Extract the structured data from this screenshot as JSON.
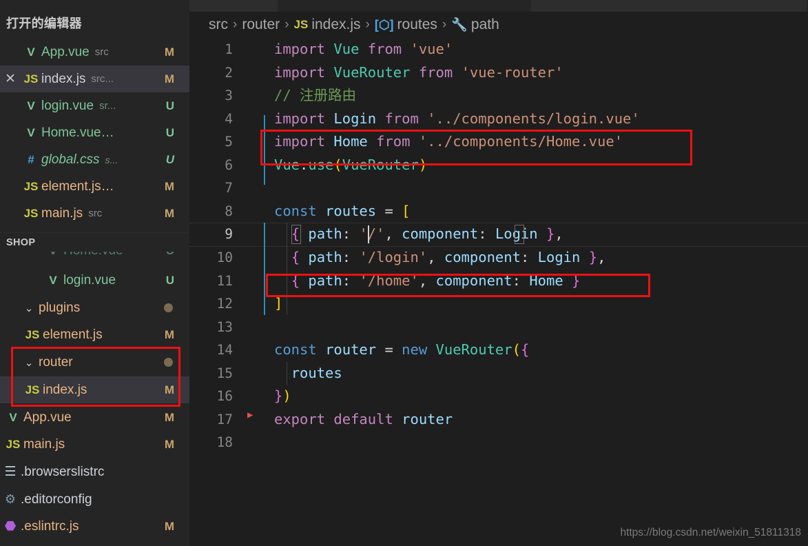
{
  "window": {
    "app": "Visual Studio Code",
    "theme_bg": "#1e1e1e",
    "sidebar_bg": "#252526",
    "accent_red": "#ee1111",
    "selection_bg": "#37373d"
  },
  "sidebar": {
    "open_editors": {
      "title": "打开的编辑器",
      "items": [
        {
          "icon": "vue-file-icon",
          "name": "App.vue",
          "path": "src",
          "status": "M",
          "selected": false,
          "closable": false,
          "italic": false
        },
        {
          "icon": "js-file-icon",
          "name": "index.js",
          "path": "src...",
          "status": "M",
          "selected": true,
          "closable": true,
          "italic": false
        },
        {
          "icon": "vue-file-icon",
          "name": "login.vue",
          "path": "sr...",
          "status": "U",
          "selected": false,
          "closable": false,
          "italic": false
        },
        {
          "icon": "vue-file-icon",
          "name": "Home.vue…",
          "path": "",
          "status": "U",
          "selected": false,
          "closable": false,
          "italic": false
        },
        {
          "icon": "css-file-icon",
          "name": "global.css",
          "path": "s...",
          "status": "U",
          "selected": false,
          "closable": false,
          "italic": true
        },
        {
          "icon": "js-file-icon",
          "name": "element.js…",
          "path": "",
          "status": "M",
          "selected": false,
          "closable": false,
          "italic": false
        },
        {
          "icon": "js-file-icon",
          "name": "main.js",
          "path": "src",
          "status": "M",
          "selected": false,
          "closable": false,
          "italic": false
        }
      ]
    },
    "explorer": {
      "title": "SHOP",
      "items": [
        {
          "icon": "vue-file-icon",
          "name": "Home.vue",
          "status": "U",
          "indent": 2,
          "kind": "file",
          "clipped": true,
          "selected": false,
          "expanded": null
        },
        {
          "icon": "vue-file-icon",
          "name": "login.vue",
          "status": "U",
          "indent": 2,
          "kind": "file",
          "clipped": false,
          "selected": false,
          "expanded": null
        },
        {
          "icon": "folder",
          "name": "plugins",
          "status": "dot",
          "indent": 1,
          "kind": "folder",
          "clipped": false,
          "selected": false,
          "expanded": true
        },
        {
          "icon": "js-file-icon",
          "name": "element.js",
          "status": "M",
          "indent": 2,
          "kind": "file",
          "clipped": false,
          "selected": false,
          "expanded": null
        },
        {
          "icon": "folder",
          "name": "router",
          "status": "dot",
          "indent": 1,
          "kind": "folder",
          "clipped": false,
          "selected": false,
          "expanded": true
        },
        {
          "icon": "js-file-icon",
          "name": "index.js",
          "status": "M",
          "indent": 2,
          "kind": "file",
          "clipped": false,
          "selected": true,
          "expanded": null
        },
        {
          "icon": "vue-file-icon",
          "name": "App.vue",
          "status": "M",
          "indent": 1,
          "kind": "file",
          "clipped": false,
          "selected": false,
          "expanded": null
        },
        {
          "icon": "js-file-icon",
          "name": "main.js",
          "status": "M",
          "indent": 1,
          "kind": "file",
          "clipped": false,
          "selected": false,
          "expanded": null
        },
        {
          "icon": "list-file-icon",
          "name": ".browserslistrc",
          "status": "",
          "indent": 0,
          "kind": "file",
          "clipped": false,
          "selected": false,
          "expanded": null
        },
        {
          "icon": "gear-file-icon",
          "name": ".editorconfig",
          "status": "",
          "indent": 0,
          "kind": "file",
          "clipped": false,
          "selected": false,
          "expanded": null
        },
        {
          "icon": "eslint-file-icon",
          "name": ".eslintrc.js",
          "status": "M",
          "indent": 0,
          "kind": "file",
          "clipped": false,
          "selected": false,
          "expanded": null
        }
      ]
    }
  },
  "editor": {
    "breadcrumb": [
      {
        "label": "src",
        "icon": ""
      },
      {
        "label": "router",
        "icon": ""
      },
      {
        "label": "index.js",
        "icon": "js-file-icon"
      },
      {
        "label": "routes",
        "icon": "symbol-variable-icon"
      },
      {
        "label": "path",
        "icon": "symbol-property-wrench-icon"
      }
    ],
    "breadcrumb_separator": "›",
    "filename": "index.js",
    "language": "javascript",
    "cursor_line": 9,
    "total_lines": 18,
    "lines": [
      {
        "n": 1,
        "text": "import Vue from 'vue'"
      },
      {
        "n": 2,
        "text": "import VueRouter from 'vue-router'"
      },
      {
        "n": 3,
        "text": "// 注册路由"
      },
      {
        "n": 4,
        "text": "import Login from '../components/login.vue'"
      },
      {
        "n": 5,
        "text": "import Home from '../components/Home.vue'"
      },
      {
        "n": 6,
        "text": "Vue.use(VueRouter)"
      },
      {
        "n": 7,
        "text": ""
      },
      {
        "n": 8,
        "text": "const routes = ["
      },
      {
        "n": 9,
        "text": "  { path: '/', component: Login },"
      },
      {
        "n": 10,
        "text": "  { path: '/login', component: Login },"
      },
      {
        "n": 11,
        "text": "  { path: '/home', component: Home }"
      },
      {
        "n": 12,
        "text": "]"
      },
      {
        "n": 13,
        "text": ""
      },
      {
        "n": 14,
        "text": "const router = new VueRouter({"
      },
      {
        "n": 15,
        "text": "  routes"
      },
      {
        "n": 16,
        "text": "})"
      },
      {
        "n": 17,
        "text": "export default router"
      },
      {
        "n": 18,
        "text": ""
      }
    ]
  },
  "annotations": [
    {
      "name": "highlight-import-home",
      "target": "code line 5"
    },
    {
      "name": "highlight-route-home",
      "target": "code line 11"
    },
    {
      "name": "highlight-router-folder",
      "target": "sidebar router/index.js"
    }
  ],
  "watermark": "https://blog.csdn.net/weixin_51811318"
}
